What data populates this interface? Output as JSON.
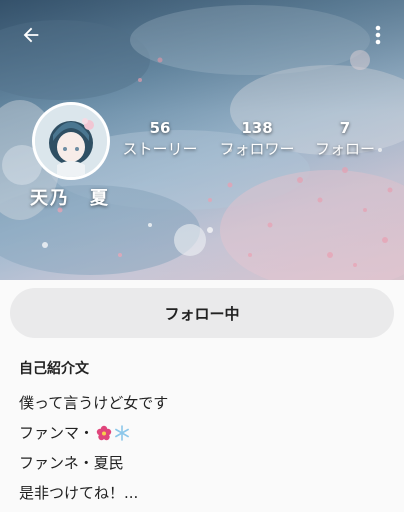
{
  "profile": {
    "name": "天乃　夏",
    "follow_button_label": "フォロー中"
  },
  "stats": [
    {
      "count": "56",
      "label": "ストーリー"
    },
    {
      "count": "138",
      "label": "フォロワー"
    },
    {
      "count": "7",
      "label": "フォロー"
    }
  ],
  "bio": {
    "title": "自己紹介文",
    "line1": "僕って言うけど女です",
    "line2_text": "ファンマ・",
    "line2_emojis": [
      "flower-emoji",
      "snowflake-emoji"
    ],
    "line3": "ファンネ・夏民",
    "line4": "是非つけてね！..."
  },
  "icons": {
    "back": "arrow-left-icon",
    "more": "more-vert-icon"
  },
  "colors": {
    "button_bg": "#eaeaeb",
    "text": "#222222",
    "overlay_text": "#ffffff"
  }
}
